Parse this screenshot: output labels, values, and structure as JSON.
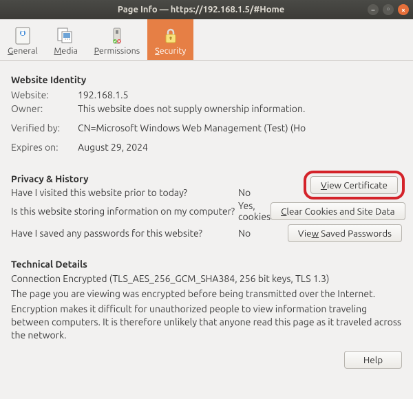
{
  "window": {
    "title": "Page Info — https://192.168.1.5/#Home"
  },
  "tabs": {
    "general": {
      "label_pre": "",
      "accel": "G",
      "label_post": "eneral"
    },
    "media": {
      "label_pre": "",
      "accel": "M",
      "label_post": "edia"
    },
    "permissions": {
      "label_pre": "",
      "accel": "P",
      "label_post": "ermissions"
    },
    "security": {
      "label_pre": "",
      "accel": "S",
      "label_post": "ecurity"
    }
  },
  "identity": {
    "heading": "Website Identity",
    "website_key": "Website:",
    "website_val": "192.168.1.5",
    "owner_key": "Owner:",
    "owner_val": "This website does not supply ownership information.",
    "verified_key": "Verified by:",
    "verified_val": "CN=Microsoft Windows Web Management (Test) (Ho",
    "expires_key": "Expires on:",
    "expires_val": "August 29, 2024",
    "view_cert_pre": "",
    "view_cert_accel": "V",
    "view_cert_post": "iew Certificate"
  },
  "privacy": {
    "heading": "Privacy & History",
    "q1": "Have I visited this website prior to today?",
    "a1": "No",
    "q2": "Is this website storing information on my computer?",
    "a2": "Yes, cookies",
    "clear_pre": "",
    "clear_accel": "C",
    "clear_post": "lear Cookies and Site Data",
    "q3": "Have I saved any passwords for this website?",
    "a3": "No",
    "view_pw_pre": "Vie",
    "view_pw_accel": "w",
    "view_pw_post": " Saved Passwords"
  },
  "technical": {
    "heading": "Technical Details",
    "line1": "Connection Encrypted (TLS_AES_256_GCM_SHA384, 256 bit keys, TLS 1.3)",
    "line2": "The page you are viewing was encrypted before being transmitted over the Internet.",
    "line3": "Encryption makes it difficult for unauthorized people to view information traveling between computers. It is therefore unlikely that anyone read this page as it traveled across the network."
  },
  "footer": {
    "help": "Help"
  }
}
